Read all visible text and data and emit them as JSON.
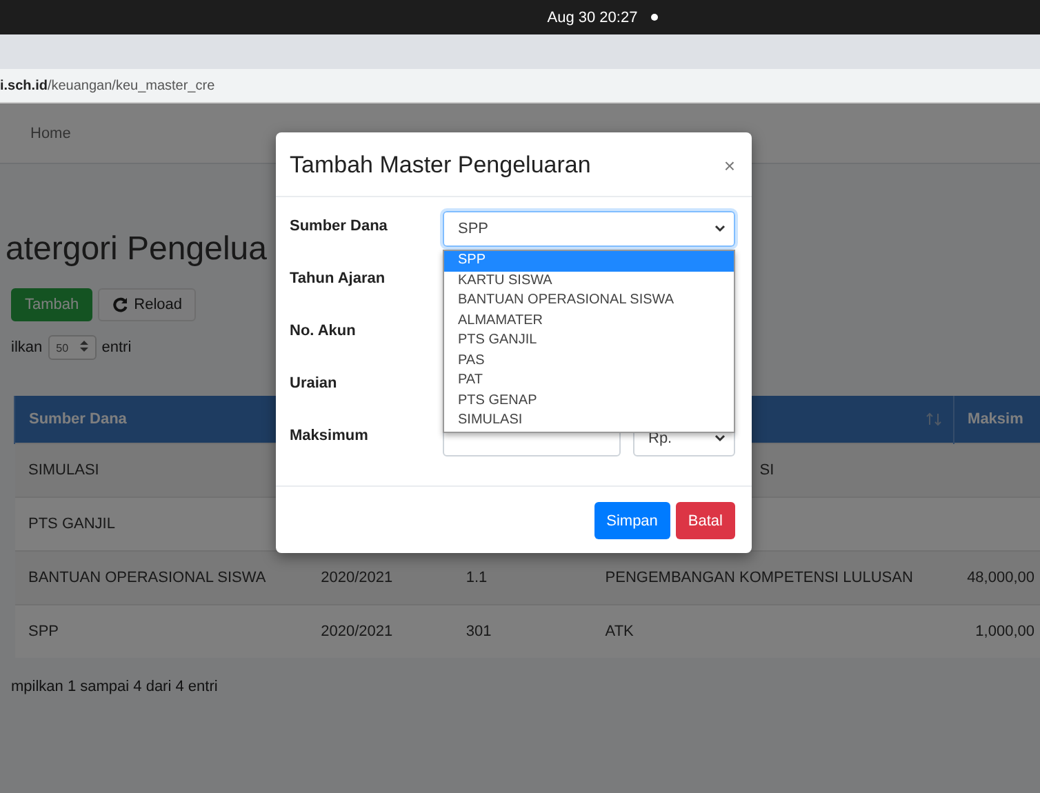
{
  "system_bar": {
    "clock": "Aug 30  20:27"
  },
  "browser": {
    "url_host": "i.sch.id",
    "url_path": "/keuangan/keu_master_cre"
  },
  "nav": {
    "items": [
      "Home"
    ]
  },
  "page": {
    "title": "atergori Pengelua",
    "buttons": [
      {
        "kind": "add",
        "label": "Tambah"
      },
      {
        "kind": "reload",
        "label": "Reload"
      }
    ],
    "length": {
      "prefix": "ilkan",
      "value": "50",
      "suffix": "entri"
    },
    "table": {
      "columns": [
        {
          "label": "Sumber Dana"
        },
        {},
        {},
        {
          "sort_icon": true
        },
        {
          "label": "Maksim"
        }
      ],
      "rows": [
        {
          "cells": [
            {
              "text": "SIMULASI"
            },
            {},
            {},
            {
              "text": "SI",
              "clipped": true
            },
            {}
          ]
        },
        {
          "cells": [
            {
              "text": "PTS GANJIL"
            },
            {},
            {},
            {},
            {}
          ]
        },
        {
          "cells": [
            {
              "text": "BANTUAN OPERASIONAL SISWA"
            },
            {
              "text": "2020/2021"
            },
            {
              "text": "1.1"
            },
            {
              "text": "PENGEMBANGAN KOMPETENSI LULUSAN"
            },
            {
              "text": "48,000,00"
            }
          ]
        },
        {
          "cells": [
            {
              "text": "SPP"
            },
            {
              "text": "2020/2021"
            },
            {
              "text": "301"
            },
            {
              "text": "ATK"
            },
            {
              "text": "1,000,00"
            }
          ]
        }
      ]
    },
    "info": "mpilkan 1 sampai 4 dari 4 entri"
  },
  "dialog": {
    "title": "Tambah Master Pengeluaran",
    "close": "×",
    "fields": [
      {
        "label": "Sumber Dana",
        "kind": "select",
        "value": "SPP",
        "expanded": true,
        "options": [
          {
            "label": "SPP",
            "selected": true
          },
          {
            "label": "KARTU SISWA",
            "selected": false
          },
          {
            "label": "BANTUAN OPERASIONAL SISWA",
            "selected": false
          },
          {
            "label": "ALMAMATER",
            "selected": false
          },
          {
            "label": "PTS GANJIL",
            "selected": false
          },
          {
            "label": "PAS",
            "selected": false
          },
          {
            "label": "PAT",
            "selected": false
          },
          {
            "label": "PTS GENAP",
            "selected": false
          },
          {
            "label": "SIMULASI",
            "selected": false
          }
        ]
      },
      {
        "label": "Tahun Ajaran",
        "kind": "hidden"
      },
      {
        "label": "No. Akun",
        "kind": "hidden"
      },
      {
        "label": "Uraian",
        "kind": "hidden"
      },
      {
        "label": "Maksimum",
        "kind": "amount",
        "currency": "Rp."
      }
    ],
    "buttons": [
      {
        "kind": "primary",
        "label": "Simpan"
      },
      {
        "kind": "danger",
        "label": "Batal"
      }
    ]
  }
}
